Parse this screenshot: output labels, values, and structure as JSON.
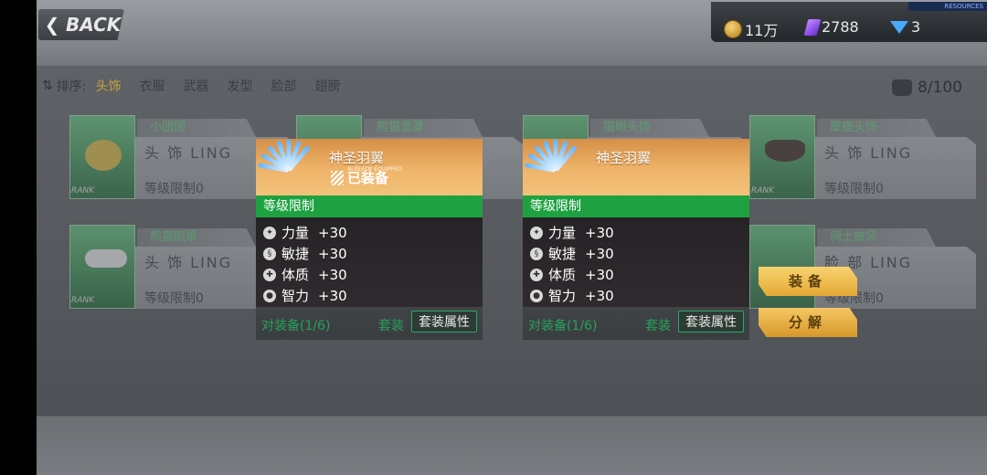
{
  "header": {
    "back_label": "BACK",
    "resources": {
      "gold": "11万",
      "crystal": "2788",
      "diamond": "3",
      "strip_label": "RESOURCES"
    }
  },
  "filter": {
    "label": "排序:",
    "tabs": [
      "头饰",
      "衣服",
      "武器",
      "发型",
      "脸部",
      "翅膀"
    ],
    "active_tab": "头饰"
  },
  "bag": {
    "count": "8/100"
  },
  "cards": [
    {
      "tag": "小团团",
      "type": "头 饰 LING",
      "req": "等级限制0",
      "rank": "RANK"
    },
    {
      "tag": "熊猫面罩",
      "type": "",
      "req": "",
      "rank": ""
    },
    {
      "tag": "猫眼头饰",
      "type": "",
      "req": "",
      "rank": ""
    },
    {
      "tag": "麋鹿头饰",
      "type": "头 饰 LING",
      "req": "等级限制0",
      "rank": "RANK"
    },
    {
      "tag": "熊猫眼罩",
      "type": "头 饰 LING",
      "req": "等级限制0",
      "rank": "RANK"
    },
    {
      "tag": "骑士披风",
      "type": "脸 部 LING",
      "req": "等级限制0",
      "rank": "RANK"
    }
  ],
  "tooltips": [
    {
      "name": "神圣羽翼",
      "equipped_label": "已装备",
      "equipped_small": "ALREADY EQUIPPED",
      "level_limit": "等级限制",
      "stats": [
        {
          "label": "力量",
          "value": "+30"
        },
        {
          "label": "敏捷",
          "value": "+30"
        },
        {
          "label": "体质",
          "value": "+30"
        },
        {
          "label": "智力",
          "value": "+30"
        }
      ],
      "set_progress": "对装备(1/6)",
      "set_prop": "套装",
      "set_button": "套装属性"
    },
    {
      "name": "神圣羽翼",
      "equipped_label": "",
      "equipped_small": "",
      "level_limit": "等级限制",
      "stats": [
        {
          "label": "力量",
          "value": "+30"
        },
        {
          "label": "敏捷",
          "value": "+30"
        },
        {
          "label": "体质",
          "value": "+30"
        },
        {
          "label": "智力",
          "value": "+30"
        }
      ],
      "set_progress": "对装备(1/6)",
      "set_prop": "套装",
      "set_button": "套装属性"
    }
  ],
  "actions": {
    "equip": "装备",
    "decompose": "分解"
  }
}
